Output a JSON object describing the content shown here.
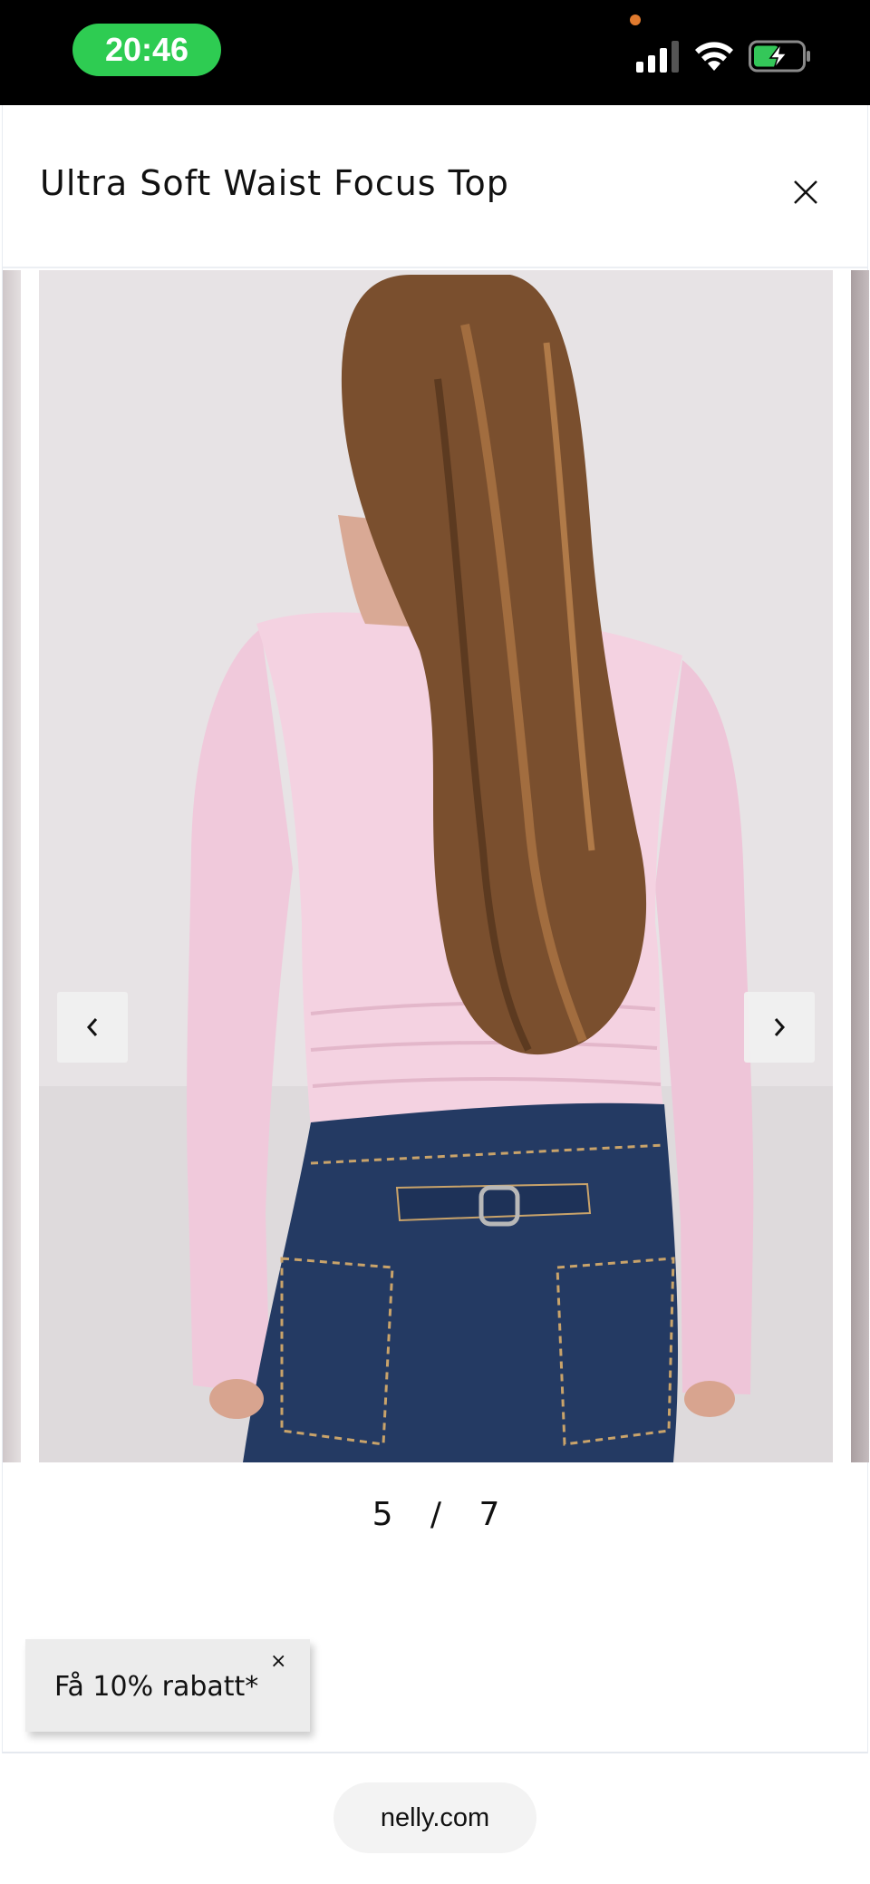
{
  "status_bar": {
    "time": "20:46",
    "icons": [
      "signal-icon",
      "wifi-icon",
      "battery-charging-icon"
    ],
    "time_pill_color": "#2ecc52",
    "battery_color": "#34c759"
  },
  "modal": {
    "title": "Ultra Soft Waist Focus Top",
    "close_icon": "close-icon"
  },
  "gallery": {
    "current": "5",
    "separator": "/",
    "total": "7",
    "prev_icon": "chevron-left-icon",
    "next_icon": "chevron-right-icon",
    "image_subject": "model-back-view-pink-top-jeans"
  },
  "toast": {
    "label": "Få 10% rabatt*",
    "close_label": "×"
  },
  "browser": {
    "url": "nelly.com"
  }
}
